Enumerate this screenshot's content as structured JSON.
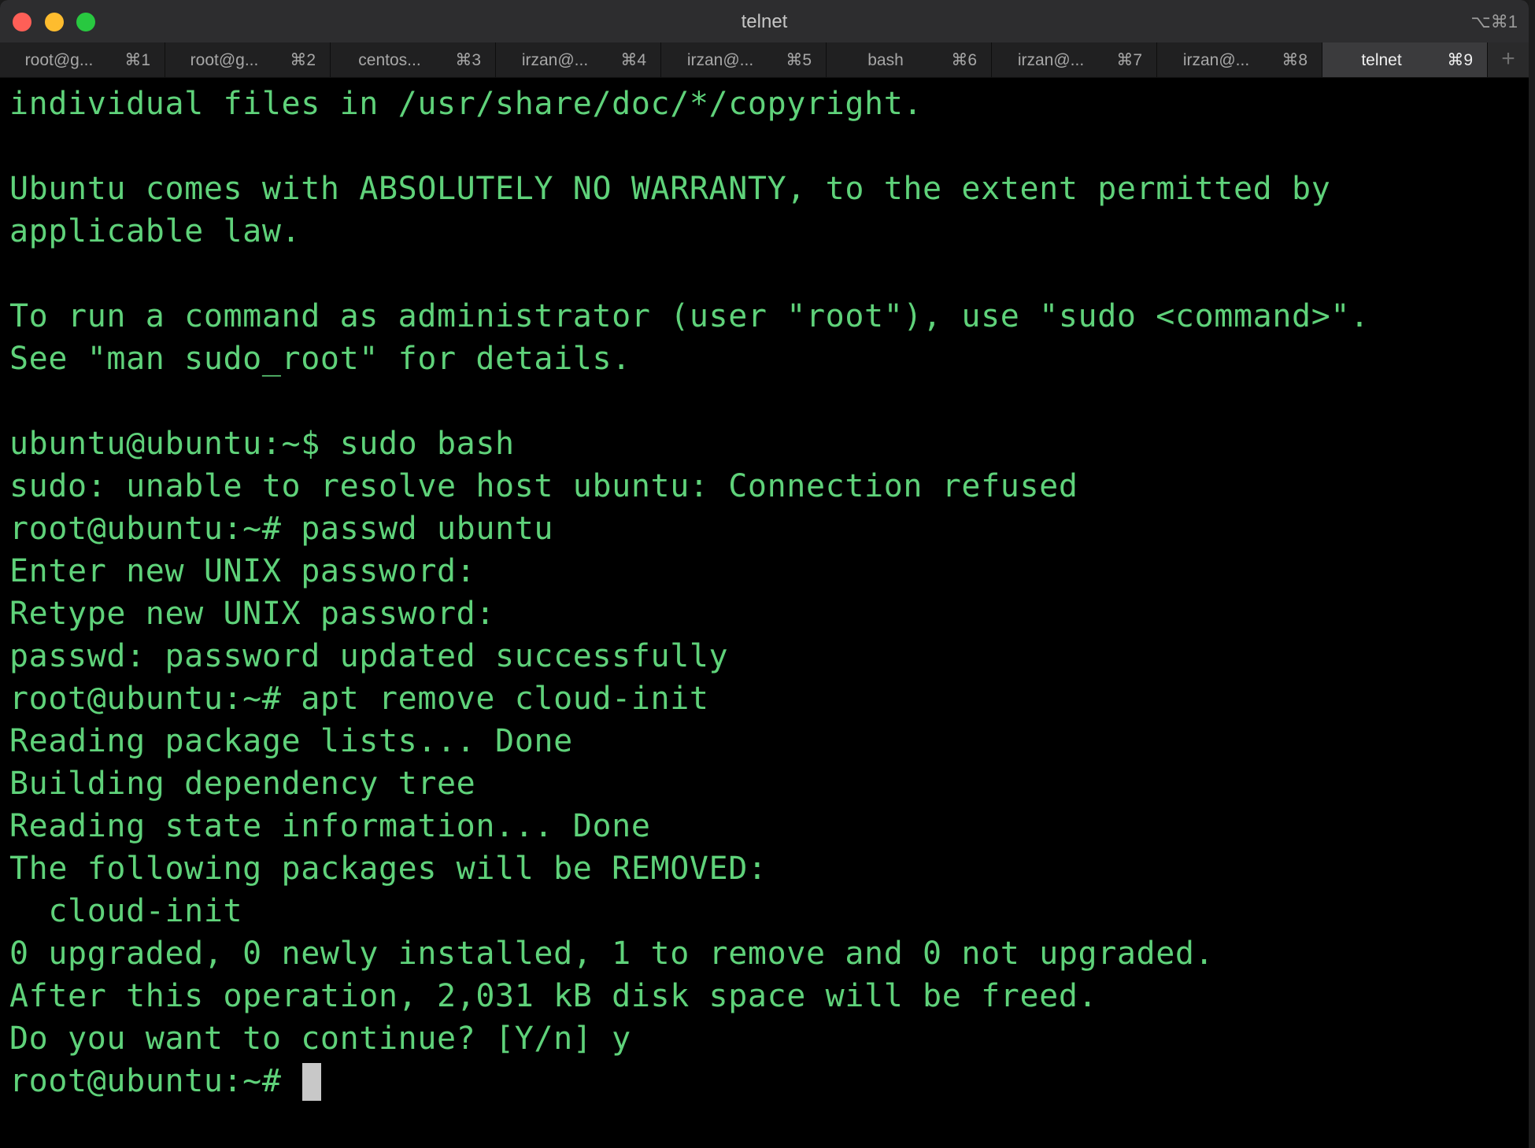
{
  "window": {
    "title": "telnet",
    "shortcut": "⌥⌘1"
  },
  "tabs": [
    {
      "label": "root@g...",
      "key": "⌘1"
    },
    {
      "label": "root@g...",
      "key": "⌘2"
    },
    {
      "label": "centos...",
      "key": "⌘3"
    },
    {
      "label": "irzan@...",
      "key": "⌘4"
    },
    {
      "label": "irzan@...",
      "key": "⌘5"
    },
    {
      "label": "bash",
      "key": "⌘6"
    },
    {
      "label": "irzan@...",
      "key": "⌘7"
    },
    {
      "label": "irzan@...",
      "key": "⌘8"
    },
    {
      "label": "telnet",
      "key": "⌘9"
    }
  ],
  "active_tab": 8,
  "new_tab_label": "+",
  "colors": {
    "terminal_text": "#5fd27a",
    "terminal_bg": "#000000"
  },
  "terminal": {
    "lines": [
      "individual files in /usr/share/doc/*/copyright.",
      "",
      "Ubuntu comes with ABSOLUTELY NO WARRANTY, to the extent permitted by",
      "applicable law.",
      "",
      "To run a command as administrator (user \"root\"), use \"sudo <command>\".",
      "See \"man sudo_root\" for details.",
      "",
      "ubuntu@ubuntu:~$ sudo bash",
      "sudo: unable to resolve host ubuntu: Connection refused",
      "root@ubuntu:~# passwd ubuntu",
      "Enter new UNIX password:",
      "Retype new UNIX password:",
      "passwd: password updated successfully",
      "root@ubuntu:~# apt remove cloud-init",
      "Reading package lists... Done",
      "Building dependency tree",
      "Reading state information... Done",
      "The following packages will be REMOVED:",
      "  cloud-init",
      "0 upgraded, 0 newly installed, 1 to remove and 0 not upgraded.",
      "After this operation, 2,031 kB disk space will be freed.",
      "Do you want to continue? [Y/n] y"
    ],
    "prompt": "root@ubuntu:~# "
  }
}
